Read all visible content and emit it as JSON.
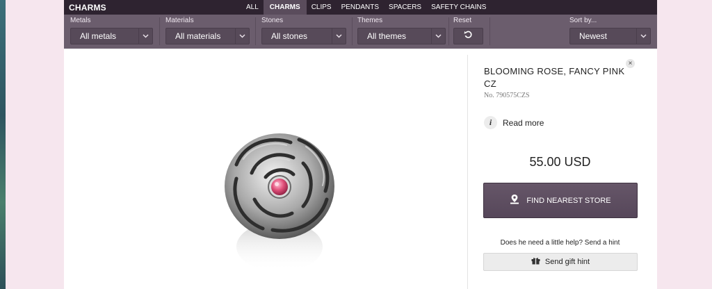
{
  "header": {
    "brand": "CHARMS",
    "tabs": [
      {
        "label": "ALL",
        "active": false
      },
      {
        "label": "CHARMS",
        "active": true
      },
      {
        "label": "CLIPS",
        "active": false
      },
      {
        "label": "PENDANTS",
        "active": false
      },
      {
        "label": "SPACERS",
        "active": false
      },
      {
        "label": "SAFETY CHAINS",
        "active": false
      }
    ]
  },
  "filters": {
    "metals": {
      "label": "Metals",
      "value": "All metals"
    },
    "materials": {
      "label": "Materials",
      "value": "All materials"
    },
    "stones": {
      "label": "Stones",
      "value": "All stones"
    },
    "themes": {
      "label": "Themes",
      "value": "All themes"
    },
    "reset": {
      "label": "Reset"
    },
    "sort": {
      "label": "Sort by...",
      "value": "Newest"
    }
  },
  "product": {
    "title": "BLOOMING ROSE, FANCY PINK CZ",
    "sku": "No. 790575CZS",
    "read_more": "Read more",
    "info_glyph": "i",
    "close_glyph": "×",
    "price": "55.00 USD",
    "find_store": "FIND NEAREST STORE",
    "hint_text": "Does he need a little help? Send a hint",
    "gift_hint": "Send gift hint"
  },
  "colors": {
    "topbar": "#2e2330",
    "filterbar": "#6b5d6d",
    "accent_button": "#5b4b5d",
    "page_background": "#f6e6ee",
    "stone": "#e0507a"
  },
  "icons": [
    "chevron-down-icon",
    "reset-icon",
    "info-icon",
    "close-icon",
    "store-pin-icon",
    "gift-icon"
  ]
}
